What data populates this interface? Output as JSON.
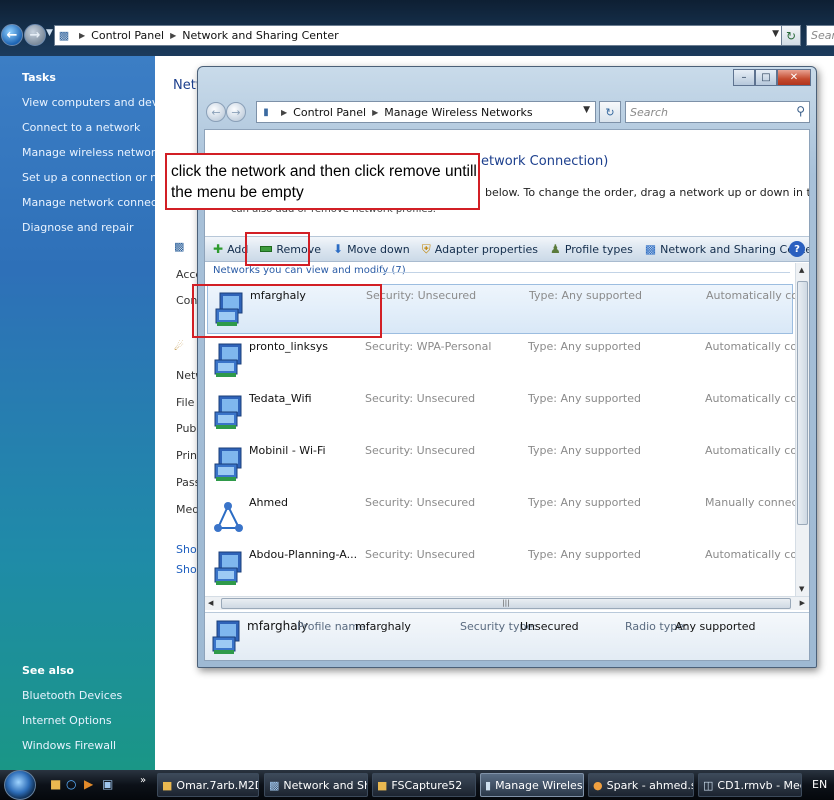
{
  "outer_window": {
    "address": [
      "Control Panel",
      "Network and Sharing Center"
    ],
    "search_placeholder": "Search",
    "page_title_partial": "Network and Sharing Center",
    "left_pane": {
      "tasks_heading": "Tasks",
      "tasks": [
        "View computers and devices",
        "Connect to a network",
        "Manage wireless networks",
        "Set up a connection or network",
        "Manage network connections",
        "Diagnose and repair"
      ],
      "see_also_heading": "See also",
      "see_also": [
        "Bluetooth Devices",
        "Internet Options",
        "Windows Firewall"
      ]
    },
    "partial_content": [
      "Acce",
      "Conr",
      "Netw",
      "File s",
      "Publi",
      "Print",
      "Passv",
      "Medi",
      "Show",
      "Show"
    ]
  },
  "inner_window": {
    "address": [
      "Control Panel",
      "Manage Wireless Networks"
    ],
    "search_placeholder": "Search",
    "heading_partial": "etwork Connection)",
    "description": "below. To change the order, drag a network up or down in the list. You",
    "description2_partial": "can also add or remove network profiles.",
    "toolbar": {
      "add": "Add",
      "remove": "Remove",
      "move_down": "Move down",
      "adapter_properties": "Adapter properties",
      "profile_types": "Profile types",
      "network_center": "Network and Sharing Center"
    },
    "group_label": "Networks you can view and modify (7)",
    "networks": [
      {
        "name": "mfarghaly",
        "security": "Unsecured",
        "type": "Any supported",
        "connect": "Automatically con...",
        "selected": true
      },
      {
        "name": "pronto_linksys",
        "security": "WPA-Personal",
        "type": "Any supported",
        "connect": "Automatically con..."
      },
      {
        "name": "Tedata_Wifi",
        "security": "Unsecured",
        "type": "Any supported",
        "connect": "Automatically con..."
      },
      {
        "name": "Mobinil -  Wi-Fi",
        "security": "Unsecured",
        "type": "Any supported",
        "connect": "Automatically con..."
      },
      {
        "name": "Ahmed",
        "security": "Unsecured",
        "type": "Any supported",
        "connect": "Manually connect",
        "adhoc": true
      },
      {
        "name": "Abdou-Planning-A...",
        "security": "Unsecured",
        "type": "Any supported",
        "connect": "Automatically con..."
      }
    ],
    "field_labels": {
      "security": "Security:",
      "type": "Type:"
    },
    "details": {
      "name": "mfarghaly",
      "profile_name_label": "Profile name:",
      "profile_name": "mfarghaly",
      "security_type_label": "Security type:",
      "security_type": "Unsecured",
      "radio_type_label": "Radio type:",
      "radio_type": "Any supported"
    }
  },
  "annotation": {
    "callout_line1": "click the network and then click remove untill",
    "callout_line2": "the menu be empty",
    "highlight_color": "#d21f25"
  },
  "taskbar": {
    "buttons": [
      "Omar.7arb.M2D",
      "Network and Sh...",
      "FSCapture52",
      "Manage Wireles...",
      "Spark - ahmed.s...",
      "CD1.rmvb - Med..."
    ],
    "language": "EN"
  }
}
